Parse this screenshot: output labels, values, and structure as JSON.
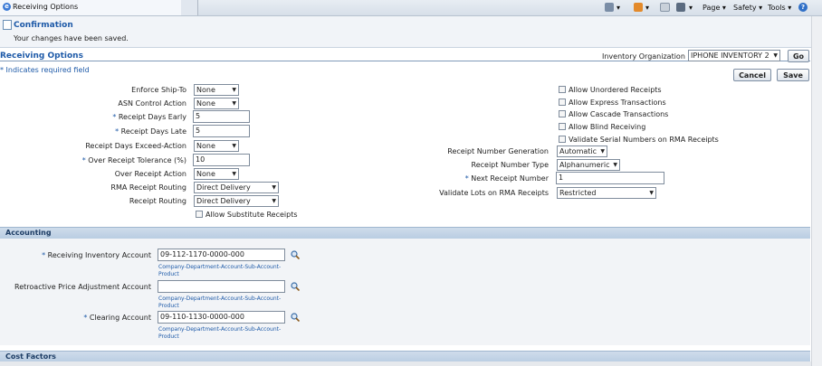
{
  "browser": {
    "tab_title": "Receiving Options",
    "toolbar": {
      "page": "Page ▾",
      "safety": "Safety ▾",
      "tools": "Tools ▾"
    }
  },
  "confirmation": {
    "title": "Confirmation",
    "message": "Your changes have been saved."
  },
  "header": {
    "title": "Receiving Options",
    "org_label": "Inventory Organization",
    "org_value": "IPHONE INVENTORY 2",
    "go": "Go",
    "required_note": "* Indicates required field",
    "cancel": "Cancel",
    "save": "Save"
  },
  "left_fields": [
    {
      "label": "Enforce Ship-To",
      "req": "",
      "type": "select",
      "value": "None"
    },
    {
      "label": "ASN Control Action",
      "req": "",
      "type": "select",
      "value": "None"
    },
    {
      "label": "Receipt Days Early",
      "req": "* ",
      "type": "text",
      "value": "5"
    },
    {
      "label": "Receipt Days Late",
      "req": "* ",
      "type": "text",
      "value": "5"
    },
    {
      "label": "Receipt Days Exceed-Action",
      "req": "",
      "type": "select",
      "value": "None"
    },
    {
      "label": "Over Receipt Tolerance (%)",
      "req": "* ",
      "type": "text",
      "value": "10"
    },
    {
      "label": "Over Receipt Action",
      "req": "",
      "type": "select",
      "value": "None"
    },
    {
      "label": "RMA Receipt Routing",
      "req": "",
      "type": "select",
      "value": "Direct Delivery"
    },
    {
      "label": "Receipt Routing",
      "req": "",
      "type": "select",
      "value": "Direct Delivery"
    }
  ],
  "allow_substitute": "Allow Substitute Receipts",
  "right_checkboxes": [
    "Allow Unordered Receipts",
    "Allow Express Transactions",
    "Allow Cascade Transactions",
    "Allow Blind Receiving",
    "Validate Serial Numbers on RMA Receipts"
  ],
  "right_fields": [
    {
      "label": "Receipt Number Generation",
      "req": "",
      "type": "select",
      "value": "Automatic"
    },
    {
      "label": "Receipt Number Type",
      "req": "",
      "type": "select",
      "value": "Alphanumeric"
    },
    {
      "label": "Next Receipt Number",
      "req": "* ",
      "type": "text",
      "value": "1"
    },
    {
      "label": "Validate Lots on RMA Receipts",
      "req": "",
      "type": "select",
      "value": "Restricted"
    }
  ],
  "accounting": {
    "title": "Accounting",
    "hint": "Company-Department-Account-Sub-Account-Product",
    "fields": [
      {
        "label": "Receiving Inventory Account",
        "req": "* ",
        "value": "09-112-1170-0000-000"
      },
      {
        "label": "Retroactive Price Adjustment Account",
        "req": "",
        "value": ""
      },
      {
        "label": "Clearing Account",
        "req": "* ",
        "value": "09-110-1130-0000-000"
      }
    ]
  },
  "cost_factors": {
    "title": "Cost Factors"
  },
  "colors": {
    "accent": "#1e5aa8",
    "section_bg": "#c4d4e6"
  }
}
